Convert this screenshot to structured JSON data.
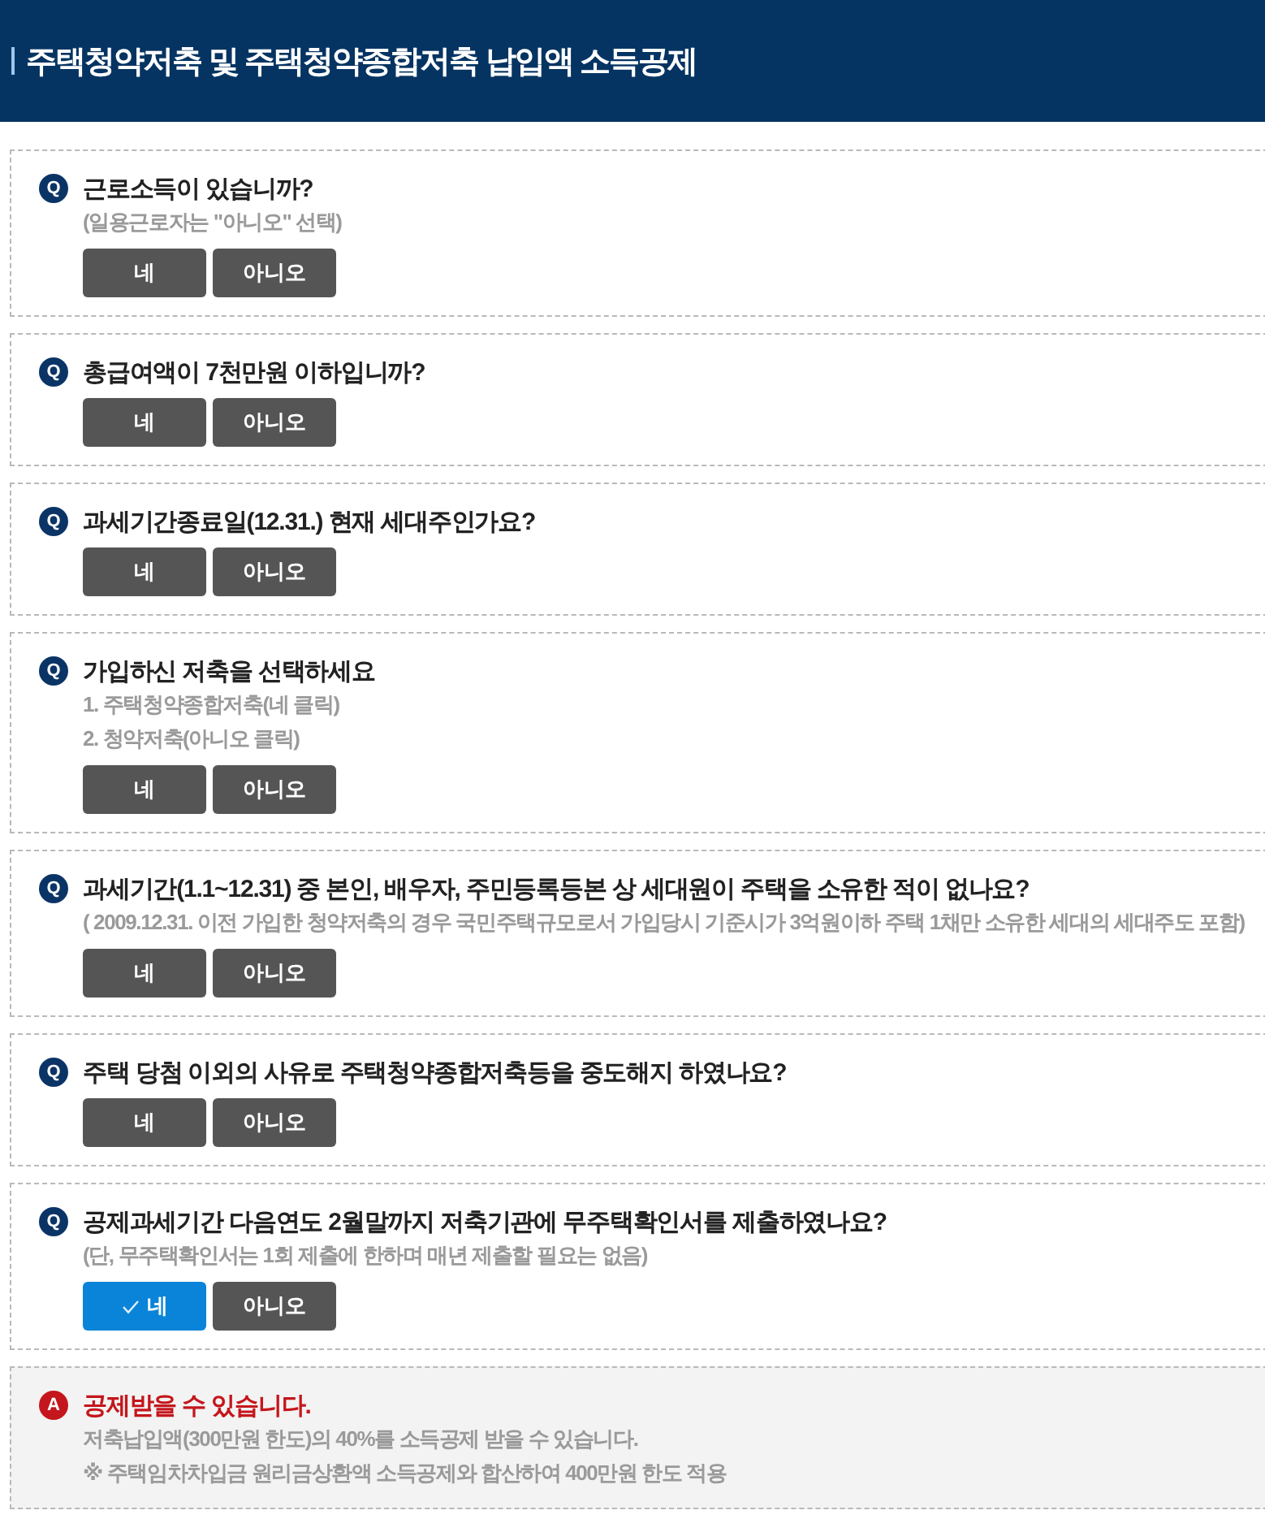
{
  "header": {
    "title": "주택청약저축 및 주택청약종합저축 납입액 소득공제"
  },
  "questions": [
    {
      "marker": "Q",
      "text": "근로소득이 있습니까?",
      "notes": [
        "(일용근로자는 \"아니오\" 선택)"
      ],
      "buttons": [
        {
          "label": "네",
          "selected": false
        },
        {
          "label": "아니오",
          "selected": false
        }
      ]
    },
    {
      "marker": "Q",
      "text": "총급여액이 7천만원 이하입니까?",
      "buttons": [
        {
          "label": "네",
          "selected": false
        },
        {
          "label": "아니오",
          "selected": false
        }
      ]
    },
    {
      "marker": "Q",
      "text": "과세기간종료일(12.31.) 현재 세대주인가요?",
      "buttons": [
        {
          "label": "네",
          "selected": false
        },
        {
          "label": "아니오",
          "selected": false
        }
      ]
    },
    {
      "marker": "Q",
      "text": "가입하신 저축을 선택하세요",
      "notes": [
        "1. 주택청약종합저축(네 클릭)",
        "2. 청약저축(아니오 클릭)"
      ],
      "buttons": [
        {
          "label": "네",
          "selected": false
        },
        {
          "label": "아니오",
          "selected": false
        }
      ]
    },
    {
      "marker": "Q",
      "text": "과세기간(1.1~12.31) 중 본인, 배우자, 주민등록등본 상 세대원이 주택을 소유한 적이 없나요?",
      "notes": [
        "( 2009.12.31. 이전 가입한 청약저축의 경우 국민주택규모로서 가입당시 기준시가 3억원이하 주택 1채만 소유한 세대의 세대주도 포함)"
      ],
      "buttons": [
        {
          "label": "네",
          "selected": false
        },
        {
          "label": "아니오",
          "selected": false
        }
      ]
    },
    {
      "marker": "Q",
      "text": "주택 당첨 이외의 사유로 주택청약종합저축등을 중도해지 하였나요?",
      "buttons": [
        {
          "label": "네",
          "selected": false
        },
        {
          "label": "아니오",
          "selected": false
        }
      ]
    },
    {
      "marker": "Q",
      "text": "공제과세기간 다음연도 2월말까지 저축기관에 무주택확인서를 제출하였나요?",
      "notes": [
        "(단, 무주택확인서는 1회 제출에 한하며 매년 제출할 필요는 없음)"
      ],
      "buttons": [
        {
          "label": "네",
          "selected": true
        },
        {
          "label": "아니오",
          "selected": false
        }
      ]
    }
  ],
  "answer": {
    "marker": "A",
    "title": "공제받을 수 있습니다.",
    "lines": [
      "저축납입액(300만원 한도)의 40%를 소득공제 받을 수 있습니다.",
      "※ 주택임차차입금 원리금상환액 소득공제와 합산하여 400만원 한도 적용"
    ]
  }
}
